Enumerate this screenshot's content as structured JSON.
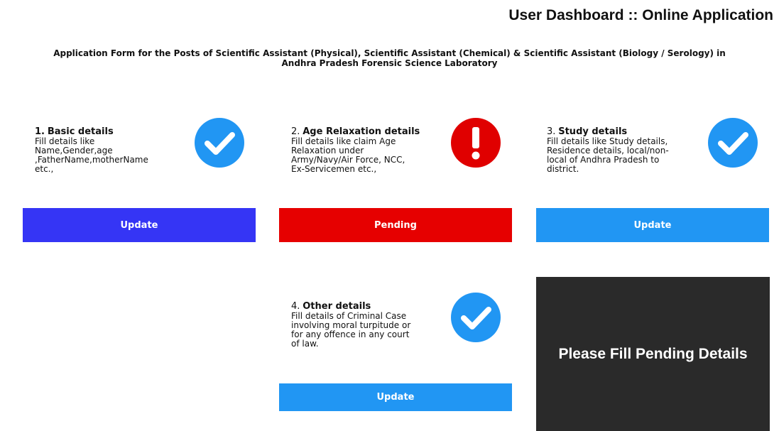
{
  "header": {
    "title": "User Dashboard :: Online Application"
  },
  "form": {
    "title_line1": "Application Form for the Posts of Scientific Assistant (Physical), Scientific Assistant (Chemical) & Scientific Assistant (Biology / Serology) in",
    "title_line2": "Andhra Pradesh Forensic Science Laboratory"
  },
  "colors": {
    "complete_icon": "#2196f3",
    "pending_icon": "#e00000",
    "update_primary": "#3535f5",
    "update_secondary": "#2196f3",
    "pending_button": "#e60000",
    "notice_bg": "#2a2a2a"
  },
  "cards": [
    {
      "number": "1.",
      "heading": "Basic details",
      "description": " Fill details like\nName,Gender,age\n,FatherName,motherName\netc.,",
      "status": "complete",
      "status_icon": "check-circle-icon",
      "button_label": "Update"
    },
    {
      "number": "2.",
      "heading": "Age Relaxation details",
      "description": " Fill details like claim Age\nRelaxation under\nArmy/Navy/Air Force, NCC,\nEx-Servicemen etc.,",
      "status": "pending",
      "status_icon": "exclamation-circle-icon",
      "button_label": "Pending"
    },
    {
      "number": "3.",
      "heading": "Study details",
      "description": "Fill details like Study details,\nResidence details, local/non-\nlocal of Andhra Pradesh to\ndistrict.",
      "status": "complete",
      "status_icon": "check-circle-icon",
      "button_label": "Update"
    },
    {
      "number": "4.",
      "heading": "Other details",
      "description": "Fill details of Criminal Case\ninvolving moral turpitude or\nfor any offence in any court\nof law.",
      "status": "complete",
      "status_icon": "check-circle-icon",
      "button_label": "Update"
    }
  ],
  "notice": {
    "text": "Please Fill Pending Details"
  }
}
